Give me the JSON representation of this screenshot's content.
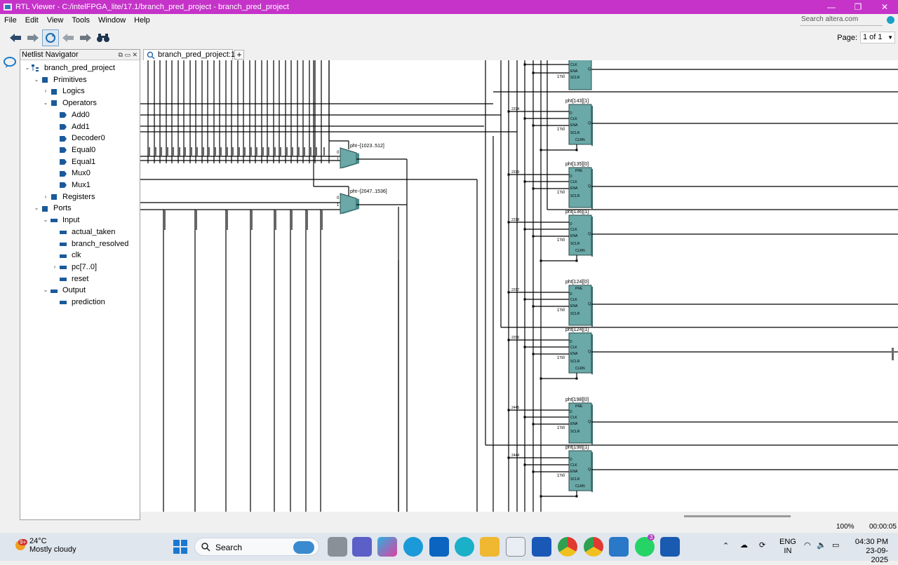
{
  "window": {
    "title": "RTL Viewer - C:/intelFPGA_lite/17.1/branch_pred_project - branch_pred_project",
    "minimize": "—",
    "maximize": "❐",
    "close": "✕"
  },
  "menu": {
    "items": [
      "File",
      "Edit",
      "View",
      "Tools",
      "Window",
      "Help"
    ],
    "search_placeholder": "Search altera.com"
  },
  "toolbar": {
    "page_label": "Page:",
    "page_value": "1 of 1"
  },
  "navigator": {
    "title": "Netlist Navigator",
    "tree": [
      {
        "label": "branch_pred_project",
        "level": 0,
        "expander": "v",
        "icon": "hierarchy-icon"
      },
      {
        "label": "Primitives",
        "level": 1,
        "expander": "v",
        "icon": "folder-icon"
      },
      {
        "label": "Logics",
        "level": 2,
        "expander": ">",
        "icon": "folder-icon"
      },
      {
        "label": "Operators",
        "level": 2,
        "expander": "v",
        "icon": "folder-icon"
      },
      {
        "label": "Add0",
        "level": 3,
        "expander": "",
        "icon": "node-icon"
      },
      {
        "label": "Add1",
        "level": 3,
        "expander": "",
        "icon": "node-icon"
      },
      {
        "label": "Decoder0",
        "level": 3,
        "expander": "",
        "icon": "node-icon"
      },
      {
        "label": "Equal0",
        "level": 3,
        "expander": "",
        "icon": "node-icon"
      },
      {
        "label": "Equal1",
        "level": 3,
        "expander": "",
        "icon": "node-icon"
      },
      {
        "label": "Mux0",
        "level": 3,
        "expander": "",
        "icon": "node-icon"
      },
      {
        "label": "Mux1",
        "level": 3,
        "expander": "",
        "icon": "node-icon"
      },
      {
        "label": "Registers",
        "level": 2,
        "expander": ">",
        "icon": "folder-icon"
      },
      {
        "label": "Ports",
        "level": 1,
        "expander": "v",
        "icon": "folder-icon"
      },
      {
        "label": "Input",
        "level": 2,
        "expander": "v",
        "icon": "port-group-icon"
      },
      {
        "label": "actual_taken",
        "level": 3,
        "expander": "",
        "icon": "port-icon"
      },
      {
        "label": "branch_resolved",
        "level": 3,
        "expander": "",
        "icon": "port-icon"
      },
      {
        "label": "clk",
        "level": 3,
        "expander": "",
        "icon": "port-icon"
      },
      {
        "label": "pc[7..0]",
        "level": 3,
        "expander": ">",
        "icon": "port-icon"
      },
      {
        "label": "reset",
        "level": 3,
        "expander": "",
        "icon": "port-icon"
      },
      {
        "label": "Output",
        "level": 2,
        "expander": "v",
        "icon": "port-group-icon"
      },
      {
        "label": "prediction",
        "level": 3,
        "expander": "",
        "icon": "port-icon"
      }
    ]
  },
  "tabs": {
    "active": "branch_pred_project:1",
    "add": "+"
  },
  "schematic": {
    "muxes": [
      {
        "label": "pht~[1023..512]",
        "in0": "0",
        "in1": "1"
      },
      {
        "label": "pht~[2047..1536]",
        "in0": "0",
        "in1": "1"
      }
    ],
    "registers": [
      {
        "label": "pht[143][1]",
        "net": "2334",
        "has_pre": false
      },
      {
        "label": "pht[135][0]",
        "net": "2319",
        "has_pre": true
      },
      {
        "label": "pht[136][1]",
        "net": "2318",
        "has_pre": false
      },
      {
        "label": "pht[124][0]",
        "net": "2297",
        "has_pre": true
      },
      {
        "label": "pht[124][1]",
        "net": "2296",
        "has_pre": false
      },
      {
        "label": "pht[198][0]",
        "net": "2445",
        "has_pre": true
      },
      {
        "label": "pht[198][1]",
        "net": "2444",
        "has_pre": false
      }
    ],
    "pin_labels": {
      "pre": "PRE",
      "d": "D",
      "clk": "CLK",
      "ena": "ENA",
      "sclr": "SCLR",
      "clrn": "CLRN",
      "q": "Q",
      "const": "1'h0"
    }
  },
  "status": {
    "zoom": "100%",
    "time": "00:00:05"
  },
  "taskbar": {
    "weather_temp": "24°C",
    "weather_cond": "Mostly cloudy",
    "weather_badge": "9+",
    "search_label": "Search",
    "lang_top": "ENG",
    "lang_bottom": "IN",
    "clock_time": "04:30 PM",
    "clock_date": "23-09-2025",
    "whatsapp_badge": "3"
  },
  "colors": {
    "title_bar": "#c533c9",
    "register_fill": "#6aa9a8",
    "taskbar": "#dfe6ee"
  }
}
